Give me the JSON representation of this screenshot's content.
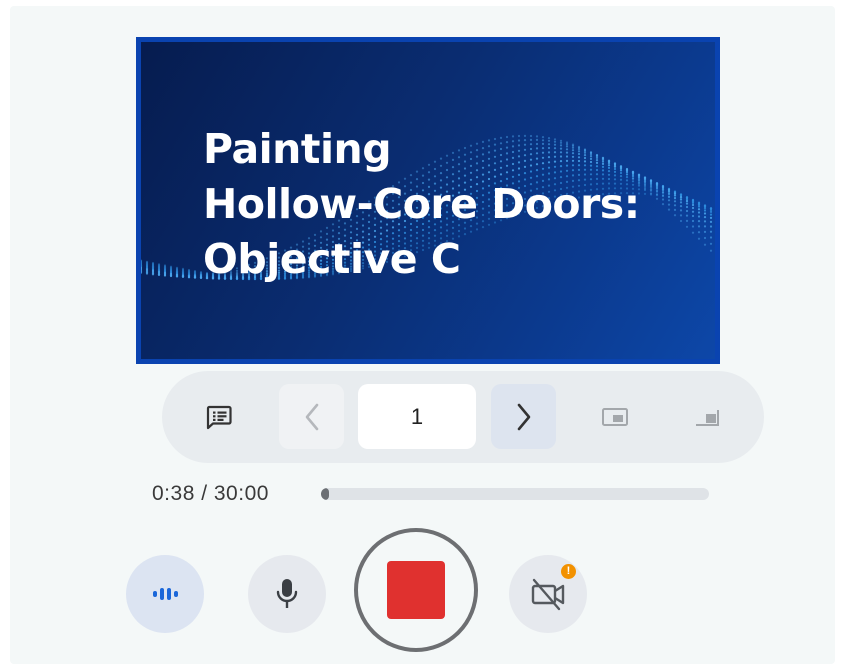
{
  "slide": {
    "title_lines": [
      "Painting",
      "Hollow-Core Doors:",
      "Objective C"
    ]
  },
  "toolbar": {
    "notes_icon": "speaker-notes-icon",
    "prev_icon": "chevron-left-icon",
    "page_number": "1",
    "next_icon": "chevron-right-icon",
    "pip_icon": "picture-in-picture-icon",
    "corner_icon": "corner-layout-icon"
  },
  "playback": {
    "time_text": "0:38 / 30:00",
    "progress_fraction": 0.021
  },
  "controls": {
    "audio_icon": "audio-level-icon",
    "mic_icon": "microphone-icon",
    "record_icon": "stop-recording-icon",
    "camera_icon": "camera-off-icon",
    "camera_warning": "!"
  },
  "colors": {
    "stop": "#e0312f",
    "slide_border": "#0a43b0",
    "warning": "#f29100"
  }
}
